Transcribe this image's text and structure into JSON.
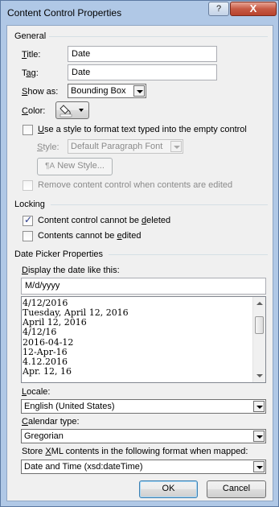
{
  "window": {
    "title": "Content Control Properties",
    "help_glyph": "?",
    "close_glyph": "X"
  },
  "general": {
    "heading": "General",
    "title_label": "Title:",
    "title_value": "Date",
    "tag_label": "Tag:",
    "tag_value": "Date",
    "show_as_label": "Show as:",
    "show_as_value": "Bounding Box",
    "color_label": "Color:",
    "use_style_label": "Use a style to format text typed into the empty control",
    "use_style_checked": false,
    "style_label": "Style:",
    "style_value": "Default Paragraph Font",
    "new_style_button": "New Style...",
    "remove_control_label": "Remove content control when contents are edited",
    "remove_control_checked": false
  },
  "locking": {
    "heading": "Locking",
    "cannot_delete_label": "Content control cannot be deleted",
    "cannot_delete_checked": true,
    "cannot_edit_label": "Contents cannot be edited",
    "cannot_edit_checked": false
  },
  "date_picker": {
    "heading": "Date Picker Properties",
    "display_label": "Display the date like this:",
    "format_value": "M/d/yyyy",
    "format_options": [
      "4/12/2016",
      "Tuesday, April 12, 2016",
      "April 12, 2016",
      "4/12/16",
      "2016-04-12",
      "12-Apr-16",
      "4.12.2016",
      "Apr. 12, 16"
    ],
    "locale_label": "Locale:",
    "locale_value": "English (United States)",
    "calendar_label": "Calendar type:",
    "calendar_value": "Gregorian",
    "store_label": "Store XML contents in the following format when mapped:",
    "store_value": "Date and Time (xsd:dateTime)"
  },
  "buttons": {
    "ok": "OK",
    "cancel": "Cancel"
  },
  "colors": {
    "accent": "#3c7fb1",
    "close_button": "#c75a44"
  }
}
